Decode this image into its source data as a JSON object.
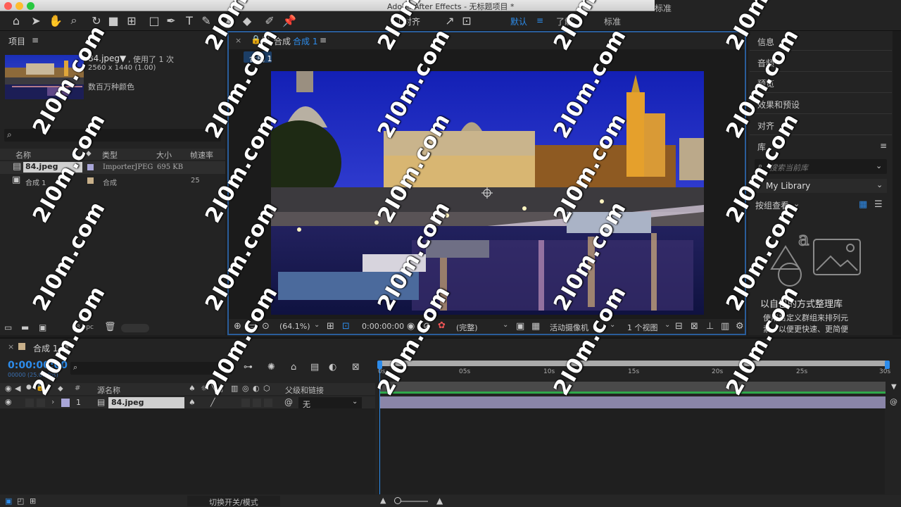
{
  "app": {
    "title": "Adobe After Effects - 无标题项目 *",
    "right_title_fragment": "标准"
  },
  "toolbar": {
    "align_label": "对齐",
    "workspaces": [
      "默认",
      "了解",
      "标准"
    ],
    "active_workspace": "默认",
    "menu_icon": "≡"
  },
  "project": {
    "title": "项目",
    "menu": "≡",
    "file_name": "84.jpeg▼",
    "used_count": ", 使用了 1 次",
    "dimensions": "2560 x 1440 (1.00)",
    "color_info": "数百万种颜色",
    "search_placeholder": "",
    "columns": [
      "名称",
      "类型",
      "大小",
      "帧速率"
    ],
    "items": [
      {
        "name": "84.jpeg",
        "type": "ImporterJPEG",
        "size": "695 KB",
        "fps": ""
      },
      {
        "name": "合成 1",
        "type": "合成",
        "size": "",
        "fps": "25"
      }
    ],
    "bpc": "8 bpc"
  },
  "viewer": {
    "tab_label": "合成",
    "tab_name": "合成 1",
    "crumb": "合成 1",
    "zoom": "(64.1%)",
    "timecode": "0:00:00:00",
    "resolution": "(完整)",
    "camera": "活动摄像机",
    "views": "1 个视图"
  },
  "right_panel": {
    "items": [
      "信息",
      "音频",
      "预览",
      "效果和预设",
      "对齐"
    ],
    "libraries_title": "库",
    "search_placeholder": "搜索当前库",
    "library_select": "My Library",
    "group_view": "按组查看",
    "promo_title": "以自己的方式整理库",
    "promo_text_line1": "使用自定义群组来排列元",
    "promo_text_line2": "素，以便更快速、更简便"
  },
  "timeline": {
    "tab_name": "合成 1",
    "timecode": "0:00:00:00",
    "fps_label": "00000 (25.00 fps)",
    "col_source": "源名称",
    "col_parent": "父级和链接",
    "col_num": "#",
    "layer": {
      "index": "1",
      "name": "84.jpeg",
      "parent": "无"
    },
    "ruler_ticks": [
      "0s",
      "05s",
      "10s",
      "15s",
      "20s",
      "25s",
      "30s"
    ],
    "toggle_label": "切换开关/模式"
  },
  "watermark": "2I0m.com",
  "colors": {
    "accent": "#2d8ceb",
    "panel_bg": "#232323",
    "layer_bar": "#8a85a8",
    "work_area": "#4a4a4a"
  }
}
